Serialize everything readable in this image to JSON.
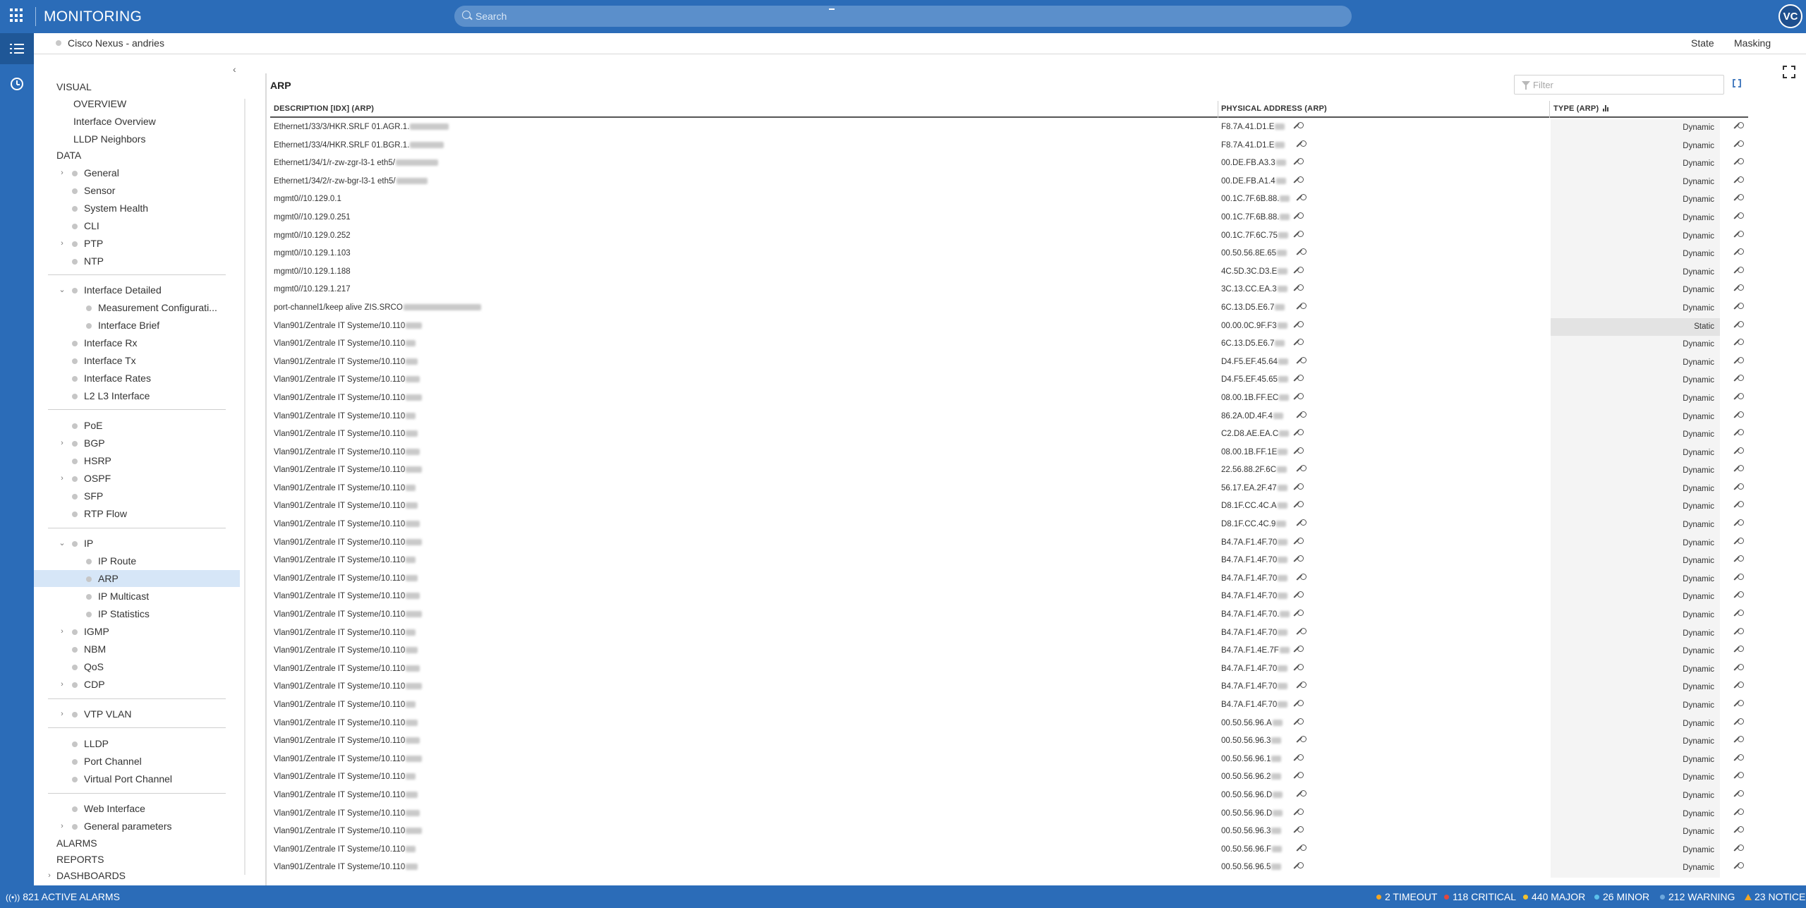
{
  "app": {
    "title": "MONITORING",
    "search_placeholder": "Search",
    "user_initials": "VC"
  },
  "device": {
    "name": "Cisco Nexus - andries",
    "links": [
      "State",
      "Masking"
    ]
  },
  "tree": {
    "visual_label": "VISUAL",
    "visual_items": [
      "OVERVIEW",
      "Interface Overview",
      "LLDP Neighbors"
    ],
    "data_label": "DATA",
    "group1": [
      {
        "label": "General",
        "expandable": true
      },
      {
        "label": "Sensor"
      },
      {
        "label": "System Health"
      },
      {
        "label": "CLI"
      },
      {
        "label": "PTP",
        "expandable": true
      },
      {
        "label": "NTP"
      }
    ],
    "interface_detailed": "Interface Detailed",
    "interface_children": [
      "Measurement Configurati...",
      "Interface Brief"
    ],
    "group2": [
      "Interface Rx",
      "Interface Tx",
      "Interface Rates",
      "L2 L3 Interface"
    ],
    "group3": [
      {
        "label": "PoE"
      },
      {
        "label": "BGP",
        "expandable": true
      },
      {
        "label": "HSRP"
      },
      {
        "label": "OSPF",
        "expandable": true
      },
      {
        "label": "SFP"
      },
      {
        "label": "RTP Flow"
      }
    ],
    "ip_label": "IP",
    "ip_children": [
      "IP Route",
      "ARP",
      "IP Multicast",
      "IP Statistics"
    ],
    "group4": [
      {
        "label": "IGMP",
        "expandable": true
      },
      {
        "label": "NBM"
      },
      {
        "label": "QoS"
      },
      {
        "label": "CDP",
        "expandable": true
      }
    ],
    "vtp_vlan": "VTP VLAN",
    "group5": [
      "LLDP",
      "Port Channel",
      "Virtual Port Channel"
    ],
    "group6": [
      {
        "label": "Web Interface"
      },
      {
        "label": "General parameters",
        "expandable": true
      }
    ],
    "alarms_label": "ALARMS",
    "reports_label": "REPORTS",
    "dashboards_label": "DASHBOARDS"
  },
  "panel": {
    "title": "ARP",
    "filter_placeholder": "Filter",
    "columns": [
      "DESCRIPTION [IDX] (ARP)",
      "PHYSICAL ADDRESS (ARP)",
      "TYPE (ARP)"
    ],
    "rows": [
      {
        "desc": "Ethernet1/33/3/HKR.SRLF 01.AGR.1.",
        "mac": "F8.7A.41.D1.E",
        "type": "Dynamic"
      },
      {
        "desc": "Ethernet1/33/4/HKR.SRLF 01.BGR.1.",
        "mac": "F8.7A.41.D1.E",
        "type": "Dynamic"
      },
      {
        "desc": "Ethernet1/34/1/r-zw-zgr-l3-1 eth5/",
        "mac": "00.DE.FB.A3.3",
        "type": "Dynamic"
      },
      {
        "desc": "Ethernet1/34/2/r-zw-bgr-l3-1 eth5/",
        "mac": "00.DE.FB.A1.4",
        "type": "Dynamic"
      },
      {
        "desc": "mgmt0//10.129.0.1",
        "mac": "00.1C.7F.6B.88.",
        "type": "Dynamic"
      },
      {
        "desc": "mgmt0//10.129.0.251",
        "mac": "00.1C.7F.6B.88.",
        "type": "Dynamic"
      },
      {
        "desc": "mgmt0//10.129.0.252",
        "mac": "00.1C.7F.6C.75",
        "type": "Dynamic"
      },
      {
        "desc": "mgmt0//10.129.1.103",
        "mac": "00.50.56.8E.65",
        "type": "Dynamic"
      },
      {
        "desc": "mgmt0//10.129.1.188",
        "mac": "4C.5D.3C.D3.E",
        "type": "Dynamic"
      },
      {
        "desc": "mgmt0//10.129.1.217",
        "mac": "3C.13.CC.EA.3",
        "type": "Dynamic"
      },
      {
        "desc": "port-channel1/keep alive ZIS.SRCO",
        "mac": "6C.13.D5.E6.7",
        "type": "Dynamic"
      },
      {
        "desc": "Vlan901/Zentrale IT Systeme/10.110",
        "mac": "00.00.0C.9F.F3",
        "type": "Static"
      },
      {
        "desc": "Vlan901/Zentrale IT Systeme/10.110",
        "mac": "6C.13.D5.E6.7",
        "type": "Dynamic"
      },
      {
        "desc": "Vlan901/Zentrale IT Systeme/10.110",
        "mac": "D4.F5.EF.45.64",
        "type": "Dynamic"
      },
      {
        "desc": "Vlan901/Zentrale IT Systeme/10.110",
        "mac": "D4.F5.EF.45.65",
        "type": "Dynamic"
      },
      {
        "desc": "Vlan901/Zentrale IT Systeme/10.110",
        "mac": "08.00.1B.FF.EC",
        "type": "Dynamic"
      },
      {
        "desc": "Vlan901/Zentrale IT Systeme/10.110",
        "mac": "86.2A.0D.4F.4",
        "type": "Dynamic"
      },
      {
        "desc": "Vlan901/Zentrale IT Systeme/10.110",
        "mac": "C2.D8.AE.EA.C",
        "type": "Dynamic"
      },
      {
        "desc": "Vlan901/Zentrale IT Systeme/10.110",
        "mac": "08.00.1B.FF.1E",
        "type": "Dynamic"
      },
      {
        "desc": "Vlan901/Zentrale IT Systeme/10.110",
        "mac": "22.56.88.2F.6C",
        "type": "Dynamic"
      },
      {
        "desc": "Vlan901/Zentrale IT Systeme/10.110",
        "mac": "56.17.EA.2F.47",
        "type": "Dynamic"
      },
      {
        "desc": "Vlan901/Zentrale IT Systeme/10.110",
        "mac": "D8.1F.CC.4C.A",
        "type": "Dynamic"
      },
      {
        "desc": "Vlan901/Zentrale IT Systeme/10.110",
        "mac": "D8.1F.CC.4C.9",
        "type": "Dynamic"
      },
      {
        "desc": "Vlan901/Zentrale IT Systeme/10.110",
        "mac": "B4.7A.F1.4F.70",
        "type": "Dynamic"
      },
      {
        "desc": "Vlan901/Zentrale IT Systeme/10.110",
        "mac": "B4.7A.F1.4F.70",
        "type": "Dynamic"
      },
      {
        "desc": "Vlan901/Zentrale IT Systeme/10.110",
        "mac": "B4.7A.F1.4F.70",
        "type": "Dynamic"
      },
      {
        "desc": "Vlan901/Zentrale IT Systeme/10.110",
        "mac": "B4.7A.F1.4F.70",
        "type": "Dynamic"
      },
      {
        "desc": "Vlan901/Zentrale IT Systeme/10.110",
        "mac": "B4.7A.F1.4F.70.",
        "type": "Dynamic"
      },
      {
        "desc": "Vlan901/Zentrale IT Systeme/10.110",
        "mac": "B4.7A.F1.4F.70",
        "type": "Dynamic"
      },
      {
        "desc": "Vlan901/Zentrale IT Systeme/10.110",
        "mac": "B4.7A.F1.4E.7F",
        "type": "Dynamic"
      },
      {
        "desc": "Vlan901/Zentrale IT Systeme/10.110",
        "mac": "B4.7A.F1.4F.70",
        "type": "Dynamic"
      },
      {
        "desc": "Vlan901/Zentrale IT Systeme/10.110",
        "mac": "B4.7A.F1.4F.70",
        "type": "Dynamic"
      },
      {
        "desc": "Vlan901/Zentrale IT Systeme/10.110",
        "mac": "B4.7A.F1.4F.70",
        "type": "Dynamic"
      },
      {
        "desc": "Vlan901/Zentrale IT Systeme/10.110",
        "mac": "00.50.56.96.A",
        "type": "Dynamic"
      },
      {
        "desc": "Vlan901/Zentrale IT Systeme/10.110",
        "mac": "00.50.56.96.3",
        "type": "Dynamic"
      },
      {
        "desc": "Vlan901/Zentrale IT Systeme/10.110",
        "mac": "00.50.56.96.1",
        "type": "Dynamic"
      },
      {
        "desc": "Vlan901/Zentrale IT Systeme/10.110",
        "mac": "00.50.56.96.2",
        "type": "Dynamic"
      },
      {
        "desc": "Vlan901/Zentrale IT Systeme/10.110",
        "mac": "00.50.56.96.D",
        "type": "Dynamic"
      },
      {
        "desc": "Vlan901/Zentrale IT Systeme/10.110",
        "mac": "00.50.56.96.D",
        "type": "Dynamic"
      },
      {
        "desc": "Vlan901/Zentrale IT Systeme/10.110",
        "mac": "00.50.56.96.3",
        "type": "Dynamic"
      },
      {
        "desc": "Vlan901/Zentrale IT Systeme/10.110",
        "mac": "00.50.56.96.F",
        "type": "Dynamic"
      },
      {
        "desc": "Vlan901/Zentrale IT Systeme/10.110",
        "mac": "00.50.56.96.5",
        "type": "Dynamic"
      }
    ]
  },
  "status": {
    "active_alarms": "821 ACTIVE ALARMS",
    "timeout": "2 TIMEOUT",
    "critical": "118 CRITICAL",
    "major": "440 MAJOR",
    "minor": "26 MINOR",
    "warning": "212 WARNING",
    "notice": "23 NOTICE"
  },
  "colors": {
    "brand": "#2b6cb8",
    "timeout": "#f5a623",
    "critical": "#e2483d",
    "major": "#f2c12e",
    "minor": "#5bc0eb",
    "warning": "#6ea8dc",
    "notice": "#f5a623"
  }
}
